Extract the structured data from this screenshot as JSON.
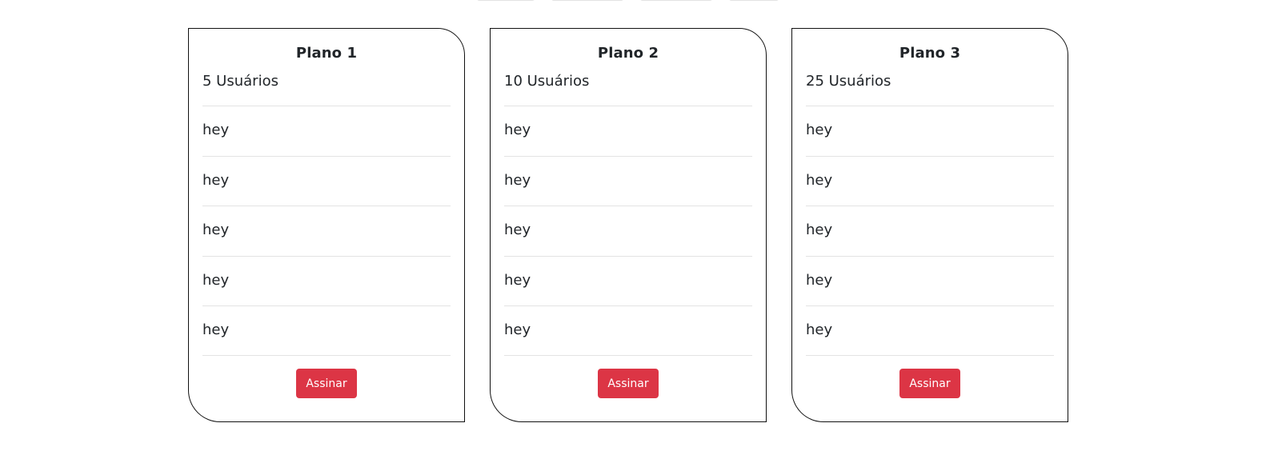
{
  "plans": [
    {
      "title": "Plano 1",
      "users": "5 Usuários",
      "features": [
        "hey",
        "hey",
        "hey",
        "hey",
        "hey"
      ],
      "button_label": "Assinar"
    },
    {
      "title": "Plano 2",
      "users": "10 Usuários",
      "features": [
        "hey",
        "hey",
        "hey",
        "hey",
        "hey"
      ],
      "button_label": "Assinar"
    },
    {
      "title": "Plano 3",
      "users": "25 Usuários",
      "features": [
        "hey",
        "hey",
        "hey",
        "hey",
        "hey"
      ],
      "button_label": "Assinar"
    }
  ],
  "colors": {
    "button": "#dc3545",
    "border": "#111111"
  }
}
